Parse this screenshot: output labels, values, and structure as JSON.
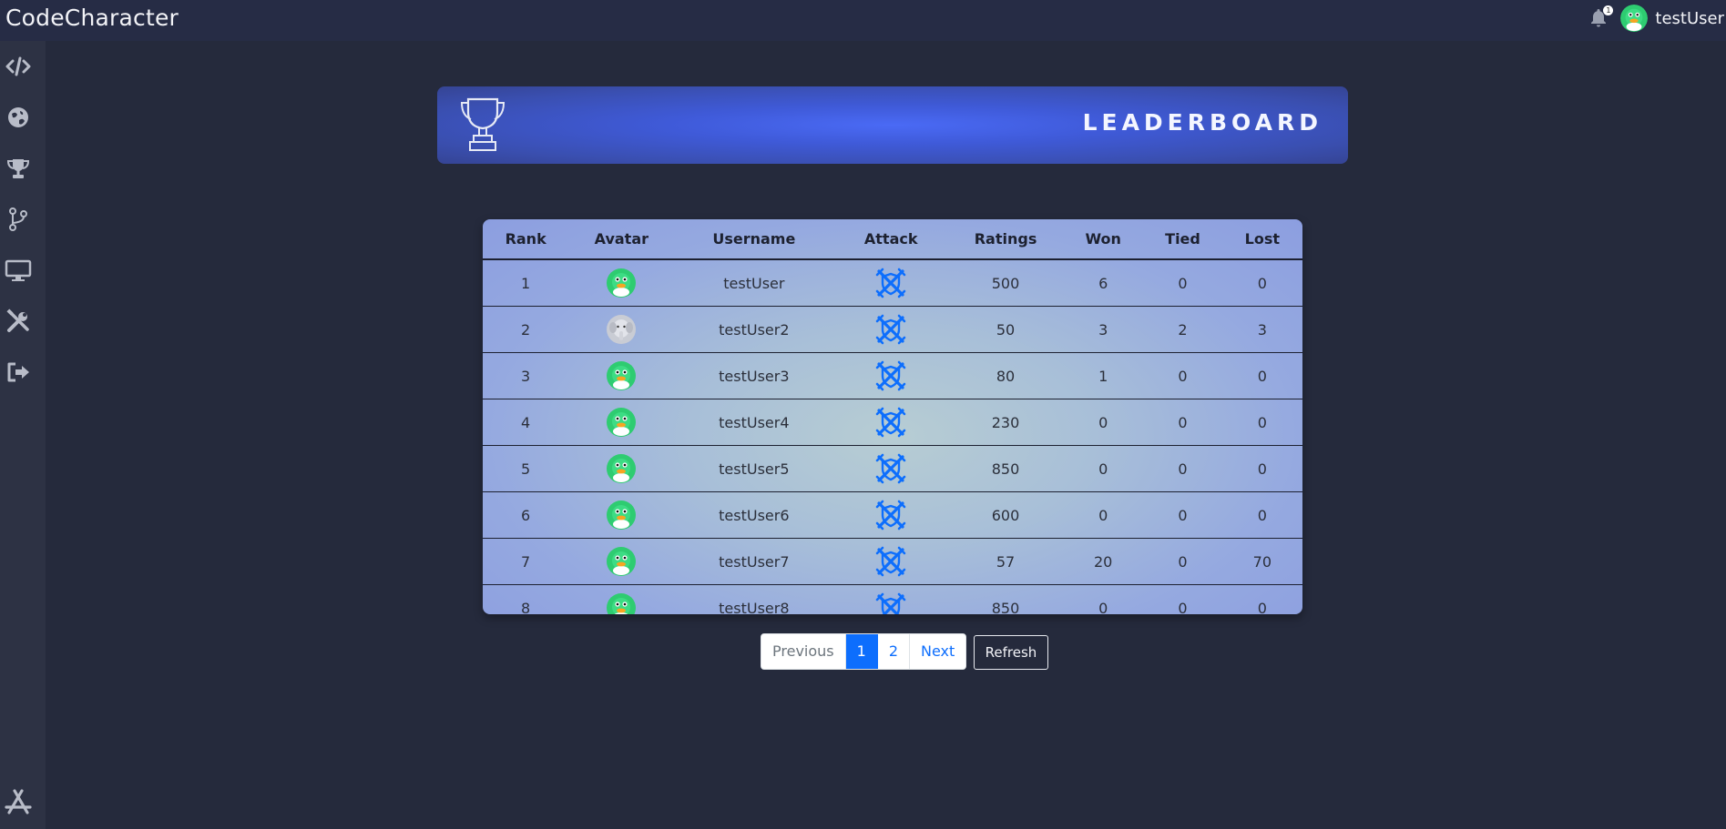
{
  "header": {
    "app_title": "CodeCharacter",
    "notification_count": "1",
    "username": "testUser"
  },
  "sidebar": {
    "items": [
      {
        "icon": "code-icon"
      },
      {
        "icon": "globe-icon"
      },
      {
        "icon": "trophy-icon"
      },
      {
        "icon": "branch-icon"
      },
      {
        "icon": "monitor-icon"
      },
      {
        "icon": "tools-icon"
      },
      {
        "icon": "logout-icon"
      }
    ],
    "footer_icon": "app-store-icon"
  },
  "banner": {
    "title": "LEADERBOARD"
  },
  "table": {
    "columns": [
      "Rank",
      "Avatar",
      "Username",
      "Attack",
      "Ratings",
      "Won",
      "Tied",
      "Lost"
    ],
    "rows": [
      {
        "rank": "1",
        "avatar": "duck",
        "username": "testUser",
        "ratings": "500",
        "won": "6",
        "tied": "0",
        "lost": "0"
      },
      {
        "rank": "2",
        "avatar": "elephant",
        "username": "testUser2",
        "ratings": "50",
        "won": "3",
        "tied": "2",
        "lost": "3"
      },
      {
        "rank": "3",
        "avatar": "duck",
        "username": "testUser3",
        "ratings": "80",
        "won": "1",
        "tied": "0",
        "lost": "0"
      },
      {
        "rank": "4",
        "avatar": "duck",
        "username": "testUser4",
        "ratings": "230",
        "won": "0",
        "tied": "0",
        "lost": "0"
      },
      {
        "rank": "5",
        "avatar": "duck",
        "username": "testUser5",
        "ratings": "850",
        "won": "0",
        "tied": "0",
        "lost": "0"
      },
      {
        "rank": "6",
        "avatar": "duck",
        "username": "testUser6",
        "ratings": "600",
        "won": "0",
        "tied": "0",
        "lost": "0"
      },
      {
        "rank": "7",
        "avatar": "duck",
        "username": "testUser7",
        "ratings": "57",
        "won": "20",
        "tied": "0",
        "lost": "70"
      },
      {
        "rank": "8",
        "avatar": "duck",
        "username": "testUser8",
        "ratings": "850",
        "won": "0",
        "tied": "0",
        "lost": "0"
      }
    ]
  },
  "pagination": {
    "previous": "Previous",
    "pages": [
      "1",
      "2"
    ],
    "active_page": "1",
    "next": "Next"
  },
  "refresh_label": "Refresh",
  "colors": {
    "page_bg": "#252a3c",
    "topbar_bg": "#262c45",
    "sidebar_bg": "#2d3244",
    "banner_accent": "#4a6af5",
    "attack_icon": "#0d6efd",
    "active_page": "#0d6efd"
  }
}
